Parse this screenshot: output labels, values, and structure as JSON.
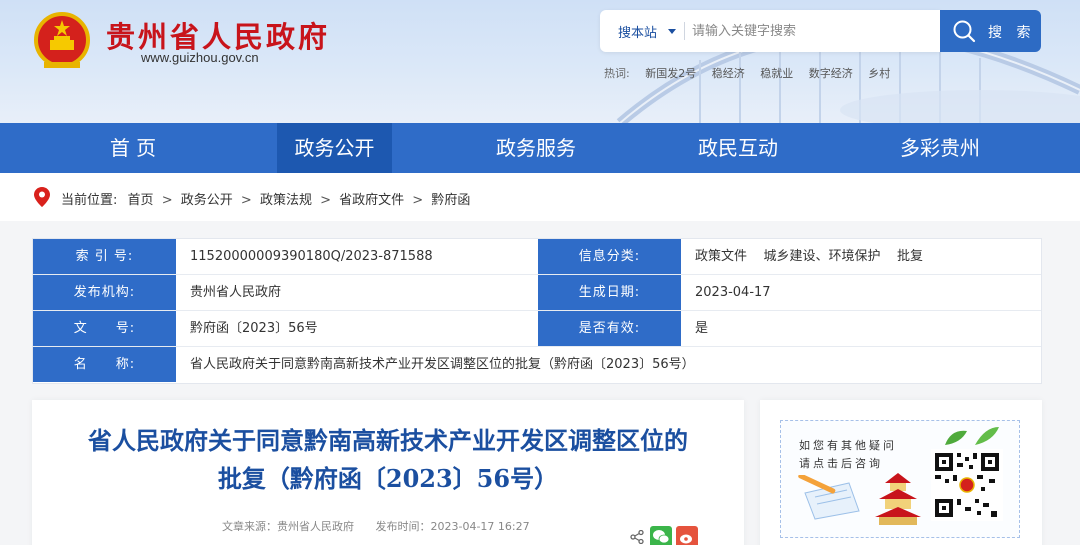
{
  "site": {
    "title": "贵州省人民政府",
    "url": "www.guizhou.gov.cn"
  },
  "search": {
    "scope": "搜本站",
    "placeholder": "请输入关键字搜索",
    "button_label": "搜 索",
    "hot_label": "热词:",
    "hot_words": [
      "新国发2号",
      "稳经济",
      "稳就业",
      "数字经济",
      "乡村"
    ]
  },
  "nav": {
    "items": [
      {
        "label": "首  页"
      },
      {
        "label": "政务公开",
        "active": true
      },
      {
        "label": "政务服务"
      },
      {
        "label": "政民互动"
      },
      {
        "label": "多彩贵州"
      }
    ]
  },
  "breadcrumb": {
    "label": "当前位置:",
    "items": [
      "首页",
      "政务公开",
      "政策法规",
      "省政府文件",
      "黔府函"
    ]
  },
  "info": {
    "index_label": "索 引 号:",
    "index_value": "11520000009390180Q/2023-871588",
    "category_label": "信息分类:",
    "category_value": "政策文件    城乡建设、环境保护    批复",
    "publisher_label": "发布机构:",
    "publisher_value": "贵州省人民政府",
    "date_label": "生成日期:",
    "date_value": "2023-04-17",
    "docno_label": "文　　号:",
    "docno_value": "黔府函〔2023〕56号",
    "valid_label": "是否有效:",
    "valid_value": "是",
    "name_label": "名　　称:",
    "name_value": "省人民政府关于同意黔南高新技术产业开发区调整区位的批复（黔府函〔2023〕56号）"
  },
  "article": {
    "title_line1": "省人民政府关于同意黔南高新技术产业开发区调整区位的",
    "title_line2": "批复（黔府函〔2023〕56号）",
    "source": "文章来源：贵州省人民政府",
    "time": "发布时间：2023-04-17 16:27"
  },
  "side": {
    "line1": "如您有其他疑问",
    "line2": "请点击后咨询"
  },
  "colors": {
    "brand_red": "#c8141b",
    "nav_blue": "#2f6cc8",
    "nav_active": "#1d58b0",
    "title_blue": "#1b4fa0"
  }
}
